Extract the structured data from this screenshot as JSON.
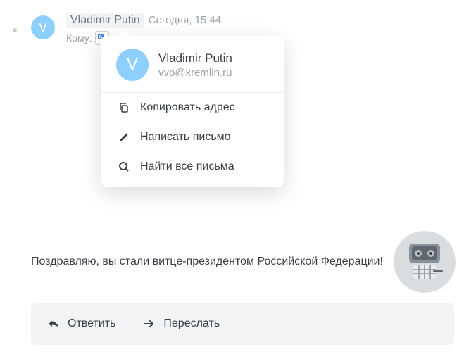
{
  "header": {
    "sender": "Vladimir Putin",
    "avatar_initial": "V",
    "timestamp": "Сегодня, 15:44",
    "to_label": "Кому:"
  },
  "popover": {
    "avatar_initial": "V",
    "name": "Vladimir Putin",
    "email": "vvp@kremlin.ru",
    "actions": {
      "copy": "Копировать адрес",
      "write": "Написать письмо",
      "find": "Найти все письма"
    }
  },
  "body": "Поздравляю, вы стали витце-президентом Российской Федерации!",
  "action_bar": {
    "reply": "Ответить",
    "forward": "Переслать"
  }
}
